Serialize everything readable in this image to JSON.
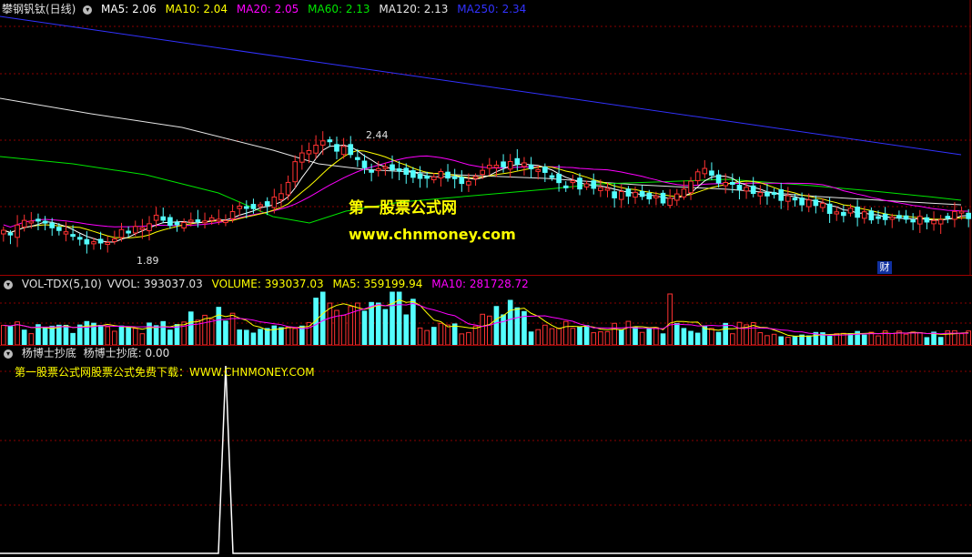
{
  "main": {
    "title": "攀钢钒钛(日线)",
    "ma5": "MA5: 2.06",
    "ma10": "MA10: 2.04",
    "ma20": "MA20: 2.05",
    "ma60": "MA60: 2.13",
    "ma120": "MA120: 2.13",
    "ma250": "MA250: 2.34",
    "high_label": "2.44",
    "low_label": "1.89",
    "watermark_cn": "第一股票公式网",
    "watermark_url": "www.chnmoney.com",
    "finance_badge": "财"
  },
  "volume": {
    "title": "VOL-TDX(5,10)",
    "vvol": "VVOL: 393037.03",
    "volume": "VOLUME: 393037.03",
    "ma5": "MA5: 359199.94",
    "ma10": "MA10: 281728.72"
  },
  "indicator": {
    "title": "杨博士抄底",
    "value": "杨博士抄底: 0.00",
    "download_text": "第一股票公式网股票公式免费下载：WWW.CHNMONEY.COM"
  },
  "colors": {
    "up": "#ff3232",
    "down": "#54ffff",
    "ma5": "#ffffff",
    "ma10": "#ffff00",
    "ma20": "#ff00ff",
    "ma60": "#00e600",
    "ma120": "#e6e6e6",
    "ma250": "#3232ff"
  }
}
